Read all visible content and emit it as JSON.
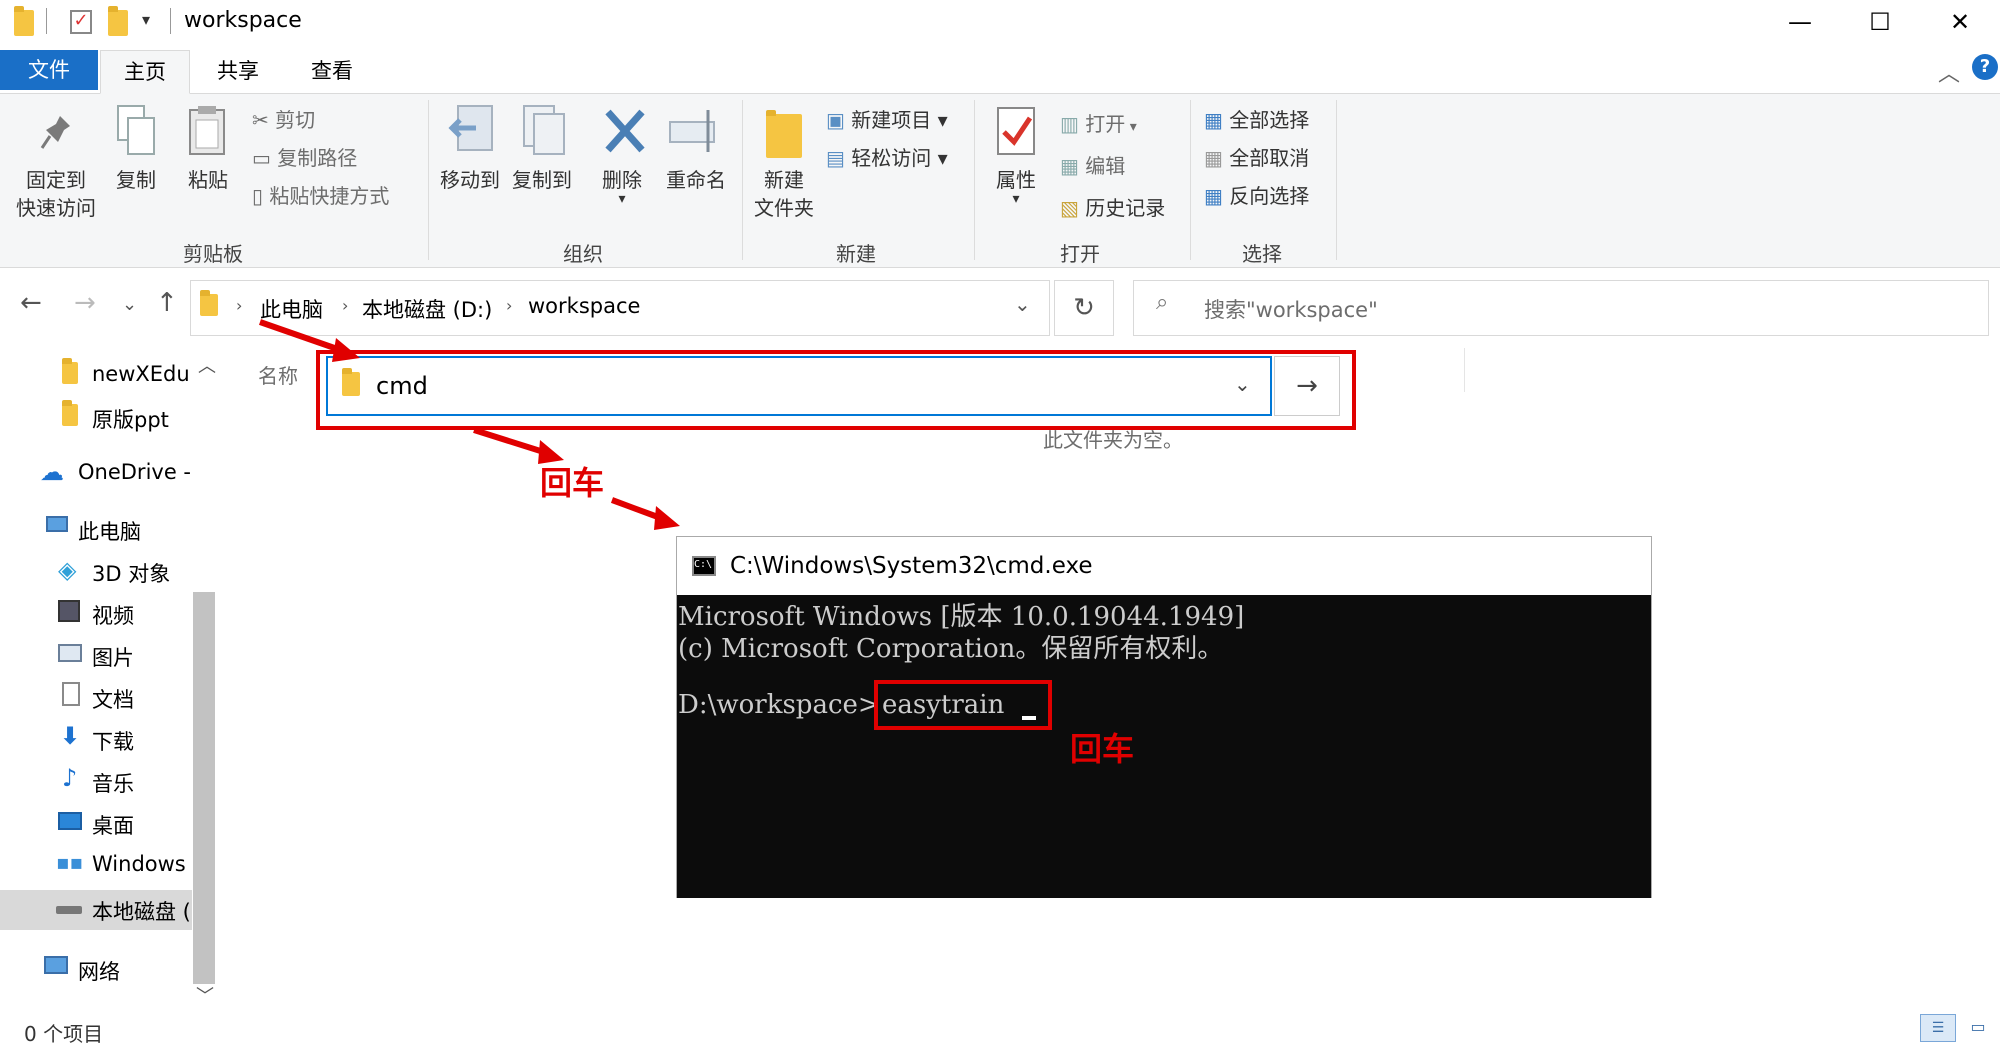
{
  "window": {
    "title": "workspace",
    "minimize": "—",
    "maximize": "☐",
    "close": "✕"
  },
  "tabs": {
    "file": "文件",
    "home": "主页",
    "share": "共享",
    "view": "查看"
  },
  "ribbon": {
    "clipboard": {
      "group": "剪贴板",
      "pin_line1": "固定到",
      "pin_line2": "快速访问",
      "copy": "复制",
      "paste": "粘贴",
      "cut": "剪切",
      "copy_path": "复制路径",
      "paste_shortcut": "粘贴快捷方式"
    },
    "organize": {
      "group": "组织",
      "move_to": "移动到",
      "copy_to": "复制到",
      "delete": "删除",
      "rename": "重命名"
    },
    "new": {
      "group": "新建",
      "new_folder_line1": "新建",
      "new_folder_line2": "文件夹",
      "new_item": "新建项目",
      "easy_access": "轻松访问"
    },
    "open": {
      "group": "打开",
      "properties": "属性",
      "open": "打开",
      "edit": "编辑",
      "history": "历史记录"
    },
    "select": {
      "group": "选择",
      "select_all": "全部选择",
      "select_none": "全部取消",
      "invert": "反向选择"
    }
  },
  "address": {
    "crumbs": [
      "此电脑",
      "本地磁盘 (D:)",
      "workspace"
    ],
    "search_placeholder": "搜索\"workspace\""
  },
  "nav": {
    "items": [
      "newXEdu",
      "原版ppt",
      "OneDrive -",
      "此电脑",
      "3D 对象",
      "视频",
      "图片",
      "文档",
      "下载",
      "音乐",
      "桌面",
      "Windows",
      "本地磁盘 (",
      "网络"
    ]
  },
  "content": {
    "column_name": "名称",
    "empty": "此文件夹为空。",
    "address_input_value": "cmd"
  },
  "cmd": {
    "title": "C:\\Windows\\System32\\cmd.exe",
    "line1": "Microsoft Windows [版本 10.0.19044.1949]",
    "line2": "(c) Microsoft Corporation。保留所有权利。",
    "prompt": "D:\\workspace>",
    "command": "easytrain"
  },
  "annotations": {
    "enter1": "回车",
    "enter2": "回车"
  },
  "status": {
    "count": "0 个项目"
  }
}
